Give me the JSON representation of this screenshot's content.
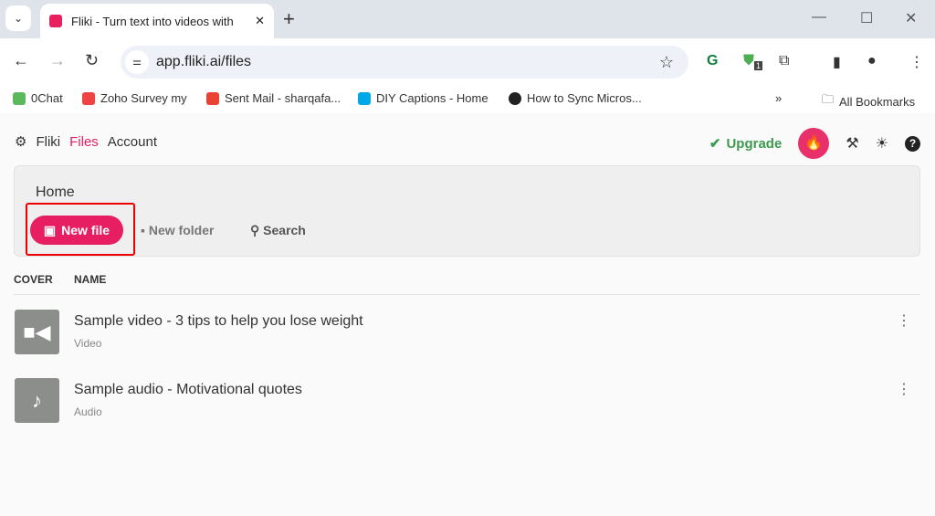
{
  "browser": {
    "tab_title": "Fliki - Turn text into videos with",
    "url": "app.fliki.ai/files",
    "extension_badge": "1",
    "bookmarks": [
      "0Chat",
      "Zoho Survey my",
      "Sent Mail - sharqafa...",
      "DIY Captions - Home",
      "How to Sync Micros..."
    ],
    "all_bookmarks": "All Bookmarks"
  },
  "nav": {
    "brand": "Fliki",
    "files": "Files",
    "account": "Account",
    "upgrade": "Upgrade"
  },
  "panel": {
    "breadcrumb": "Home",
    "new_file": "New file",
    "new_folder": "New folder",
    "search": "Search"
  },
  "table": {
    "columns": [
      "COVER",
      "NAME"
    ],
    "rows": [
      {
        "title": "Sample video - 3 tips to help you lose weight",
        "type": "Video",
        "icon": "video-camera-icon"
      },
      {
        "title": "Sample audio - Motivational quotes",
        "type": "Audio",
        "icon": "music-note-icon"
      }
    ]
  },
  "colors": {
    "accent": "#e71f62",
    "upgrade": "#3d9a4e"
  }
}
